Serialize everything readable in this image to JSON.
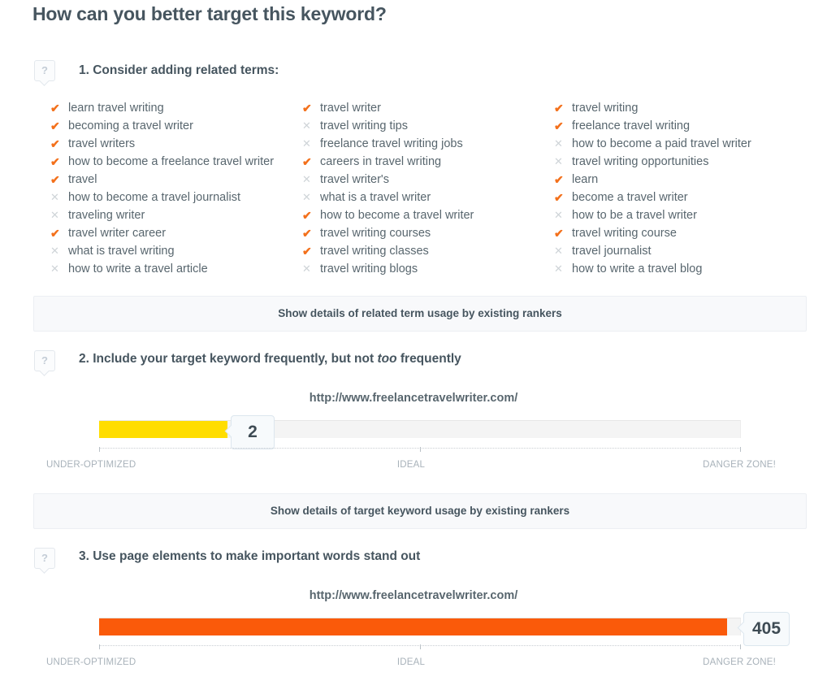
{
  "page": {
    "title": "How can you better target this keyword?"
  },
  "help_icon_glyph": "?",
  "sections": [
    {
      "heading": "1. Consider adding related terms:",
      "details_bar": "Show details of related term usage by existing rankers"
    },
    {
      "heading_pre": "2. Include your target keyword frequently, but not ",
      "heading_em": "too",
      "heading_post": " frequently",
      "details_bar": "Show details of target keyword usage by existing rankers"
    },
    {
      "heading": "3. Use page elements to make important words stand out"
    }
  ],
  "related_terms": {
    "columns": [
      [
        {
          "label": "learn travel writing",
          "included": true
        },
        {
          "label": "becoming a travel writer",
          "included": true
        },
        {
          "label": "travel writers",
          "included": true
        },
        {
          "label": "how to become a freelance travel writer",
          "included": true
        },
        {
          "label": "travel",
          "included": true
        },
        {
          "label": "how to become a travel journalist",
          "included": false
        },
        {
          "label": "traveling writer",
          "included": false
        },
        {
          "label": "travel writer career",
          "included": true
        },
        {
          "label": "what is travel writing",
          "included": false
        },
        {
          "label": "how to write a travel article",
          "included": false
        }
      ],
      [
        {
          "label": "travel writer",
          "included": true
        },
        {
          "label": "travel writing tips",
          "included": false
        },
        {
          "label": "freelance travel writing jobs",
          "included": false
        },
        {
          "label": "careers in travel writing",
          "included": true
        },
        {
          "label": "travel writer's",
          "included": false
        },
        {
          "label": "what is a travel writer",
          "included": false
        },
        {
          "label": "how to become a travel writer",
          "included": true
        },
        {
          "label": "travel writing courses",
          "included": true
        },
        {
          "label": "travel writing classes",
          "included": true
        },
        {
          "label": "travel writing blogs",
          "included": false
        }
      ],
      [
        {
          "label": "travel writing",
          "included": true
        },
        {
          "label": "freelance travel writing",
          "included": true
        },
        {
          "label": "how to become a paid travel writer",
          "included": false
        },
        {
          "label": "travel writing opportunities",
          "included": false
        },
        {
          "label": "learn",
          "included": true
        },
        {
          "label": "become a travel writer",
          "included": true
        },
        {
          "label": "how to be a travel writer",
          "included": false
        },
        {
          "label": "travel writing course",
          "included": true
        },
        {
          "label": "travel journalist",
          "included": false
        },
        {
          "label": "how to write a travel blog",
          "included": false
        }
      ]
    ],
    "marks": {
      "yes": "✔",
      "no": "✕"
    }
  },
  "gauges": [
    {
      "url": "http://www.freelancetravelwriter.com/",
      "value": "2",
      "fill_color": "#ffdd00",
      "fill_percent": 20,
      "labels": {
        "start": "UNDER-OPTIMIZED",
        "middle": "IDEAL",
        "end": "DANGER ZONE!"
      }
    },
    {
      "url": "http://www.freelancetravelwriter.com/",
      "value": "405",
      "fill_color": "#fa5a0a",
      "fill_percent": 98,
      "labels": {
        "start": "UNDER-OPTIMIZED",
        "middle": "IDEAL",
        "end": "DANGER ZONE!"
      }
    }
  ],
  "chart_data": [
    {
      "type": "bar",
      "title": "Target keyword usage",
      "categories": [
        "http://www.freelancetravelwriter.com/"
      ],
      "values": [
        2
      ],
      "xlabel": "",
      "ylabel": "",
      "tick_labels": [
        "UNDER-OPTIMIZED",
        "IDEAL",
        "DANGER ZONE!"
      ],
      "grid": false,
      "legend": "none"
    },
    {
      "type": "bar",
      "title": "Page element usage",
      "categories": [
        "http://www.freelancetravelwriter.com/"
      ],
      "values": [
        405
      ],
      "xlabel": "",
      "ylabel": "",
      "tick_labels": [
        "UNDER-OPTIMIZED",
        "IDEAL",
        "DANGER ZONE!"
      ],
      "grid": false,
      "legend": "none"
    }
  ]
}
